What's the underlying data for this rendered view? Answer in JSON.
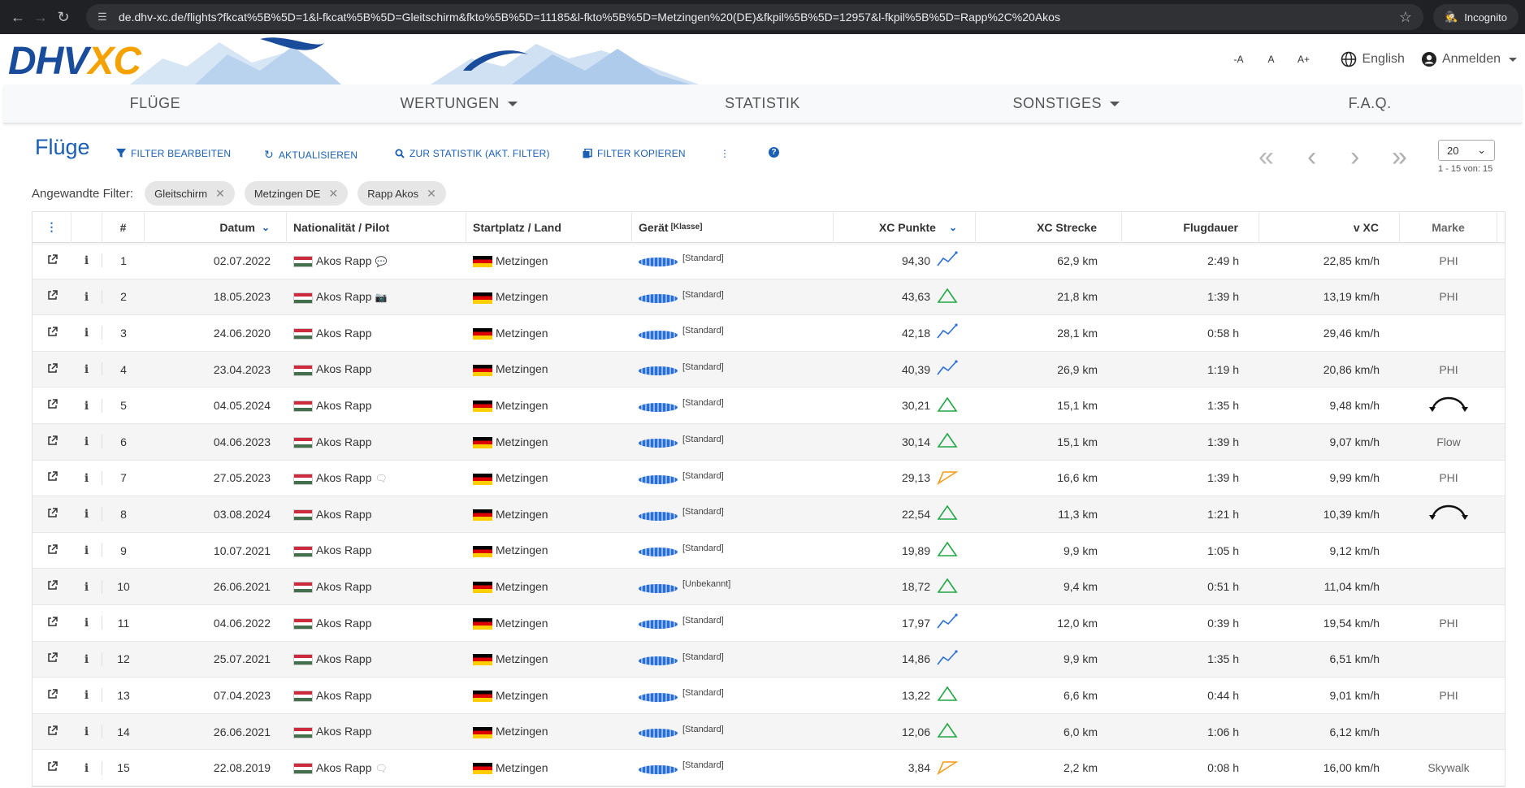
{
  "browser": {
    "url": "de.dhv-xc.de/flights?fkcat%5B%5D=1&l-fkcat%5B%5D=Gleitschirm&fkto%5B%5D=11185&l-fkto%5B%5D=Metzingen%20(DE)&fkpil%5B%5D=12957&l-fkpil%5B%5D=Rapp%2C%20Akos",
    "incognito_label": "Incognito"
  },
  "header": {
    "logo_dhv": "DHV",
    "logo_xc": "XC",
    "font_small": "-A",
    "font_normal": "A",
    "font_large": "A+",
    "language": "English",
    "login": "Anmelden"
  },
  "nav": {
    "items": [
      "FLÜGE",
      "WERTUNGEN",
      "STATISTIK",
      "SONSTIGES",
      "F.A.Q."
    ]
  },
  "toolbar": {
    "title": "Flüge",
    "filter_edit": "FILTER BEARBEITEN",
    "refresh": "AKTUALISIEREN",
    "to_stats": "ZUR STATISTIK (AKT. FILTER)",
    "copy_filter": "FILTER KOPIEREN",
    "page_size": "20",
    "count": "1 - 15 von: 15"
  },
  "filters": {
    "label": "Angewandte Filter:",
    "chips": [
      "Gleitschirm",
      "Metzingen DE",
      "Rapp Akos"
    ]
  },
  "table": {
    "headers": {
      "num": "#",
      "date": "Datum",
      "pilot": "Nationalität / Pilot",
      "launch": "Startplatz / Land",
      "glider": "Gerät",
      "klasse": "[Klasse]",
      "points": "XC Punkte",
      "distance": "XC Strecke",
      "duration": "Flugdauer",
      "speed": "v XC",
      "brand": "Marke"
    },
    "rows": [
      {
        "n": "1",
        "date": "02.07.2022",
        "pilot": "Akos Rapp",
        "extra": "comments",
        "launch": "Metzingen",
        "class": "[Standard]",
        "points": "94,30",
        "type": "free",
        "dist": "62,9 km",
        "dur": "2:49 h",
        "speed": "22,85 km/h",
        "brand": "PHI"
      },
      {
        "n": "2",
        "date": "18.05.2023",
        "pilot": "Akos Rapp",
        "extra": "camera",
        "launch": "Metzingen",
        "class": "[Standard]",
        "points": "43,63",
        "type": "triangle",
        "dist": "21,8 km",
        "dur": "1:39 h",
        "speed": "13,19 km/h",
        "brand": "PHI"
      },
      {
        "n": "3",
        "date": "24.06.2020",
        "pilot": "Akos Rapp",
        "extra": "",
        "launch": "Metzingen",
        "class": "[Standard]",
        "points": "42,18",
        "type": "free",
        "dist": "28,1 km",
        "dur": "0:58 h",
        "speed": "29,46 km/h",
        "brand": ""
      },
      {
        "n": "4",
        "date": "23.04.2023",
        "pilot": "Akos Rapp",
        "extra": "",
        "launch": "Metzingen",
        "class": "[Standard]",
        "points": "40,39",
        "type": "free",
        "dist": "26,9 km",
        "dur": "1:19 h",
        "speed": "20,86 km/h",
        "brand": "PHI"
      },
      {
        "n": "5",
        "date": "04.05.2024",
        "pilot": "Akos Rapp",
        "extra": "",
        "launch": "Metzingen",
        "class": "[Standard]",
        "points": "30,21",
        "type": "triangle",
        "dist": "15,1 km",
        "dur": "1:35 h",
        "speed": "9,48 km/h",
        "brand": "logo"
      },
      {
        "n": "6",
        "date": "04.06.2023",
        "pilot": "Akos Rapp",
        "extra": "",
        "launch": "Metzingen",
        "class": "[Standard]",
        "points": "30,14",
        "type": "triangle",
        "dist": "15,1 km",
        "dur": "1:39 h",
        "speed": "9,07 km/h",
        "brand": "Flow"
      },
      {
        "n": "7",
        "date": "27.05.2023",
        "pilot": "Akos Rapp",
        "extra": "comment",
        "launch": "Metzingen",
        "class": "[Standard]",
        "points": "29,13",
        "type": "flat",
        "dist": "16,6 km",
        "dur": "1:39 h",
        "speed": "9,99 km/h",
        "brand": "PHI"
      },
      {
        "n": "8",
        "date": "03.08.2024",
        "pilot": "Akos Rapp",
        "extra": "",
        "launch": "Metzingen",
        "class": "[Standard]",
        "points": "22,54",
        "type": "triangle",
        "dist": "11,3 km",
        "dur": "1:21 h",
        "speed": "10,39 km/h",
        "brand": "logo"
      },
      {
        "n": "9",
        "date": "10.07.2021",
        "pilot": "Akos Rapp",
        "extra": "",
        "launch": "Metzingen",
        "class": "[Standard]",
        "points": "19,89",
        "type": "triangle",
        "dist": "9,9 km",
        "dur": "1:05 h",
        "speed": "9,12 km/h",
        "brand": ""
      },
      {
        "n": "10",
        "date": "26.06.2021",
        "pilot": "Akos Rapp",
        "extra": "",
        "launch": "Metzingen",
        "class": "[Unbekannt]",
        "points": "18,72",
        "type": "triangle",
        "dist": "9,4 km",
        "dur": "0:51 h",
        "speed": "11,04 km/h",
        "brand": ""
      },
      {
        "n": "11",
        "date": "04.06.2022",
        "pilot": "Akos Rapp",
        "extra": "",
        "launch": "Metzingen",
        "class": "[Standard]",
        "points": "17,97",
        "type": "free",
        "dist": "12,0 km",
        "dur": "0:39 h",
        "speed": "19,54 km/h",
        "brand": "PHI"
      },
      {
        "n": "12",
        "date": "25.07.2021",
        "pilot": "Akos Rapp",
        "extra": "",
        "launch": "Metzingen",
        "class": "[Standard]",
        "points": "14,86",
        "type": "free",
        "dist": "9,9 km",
        "dur": "1:35 h",
        "speed": "6,51 km/h",
        "brand": ""
      },
      {
        "n": "13",
        "date": "07.04.2023",
        "pilot": "Akos Rapp",
        "extra": "",
        "launch": "Metzingen",
        "class": "[Standard]",
        "points": "13,22",
        "type": "triangle",
        "dist": "6,6 km",
        "dur": "0:44 h",
        "speed": "9,01 km/h",
        "brand": "PHI"
      },
      {
        "n": "14",
        "date": "26.06.2021",
        "pilot": "Akos Rapp",
        "extra": "",
        "launch": "Metzingen",
        "class": "[Standard]",
        "points": "12,06",
        "type": "triangle",
        "dist": "6,0 km",
        "dur": "1:06 h",
        "speed": "6,12 km/h",
        "brand": ""
      },
      {
        "n": "15",
        "date": "22.08.2019",
        "pilot": "Akos Rapp",
        "extra": "comment",
        "launch": "Metzingen",
        "class": "[Standard]",
        "points": "3,84",
        "type": "flat",
        "dist": "2,2 km",
        "dur": "0:08 h",
        "speed": "16,00 km/h",
        "brand": "Skywalk"
      }
    ]
  }
}
